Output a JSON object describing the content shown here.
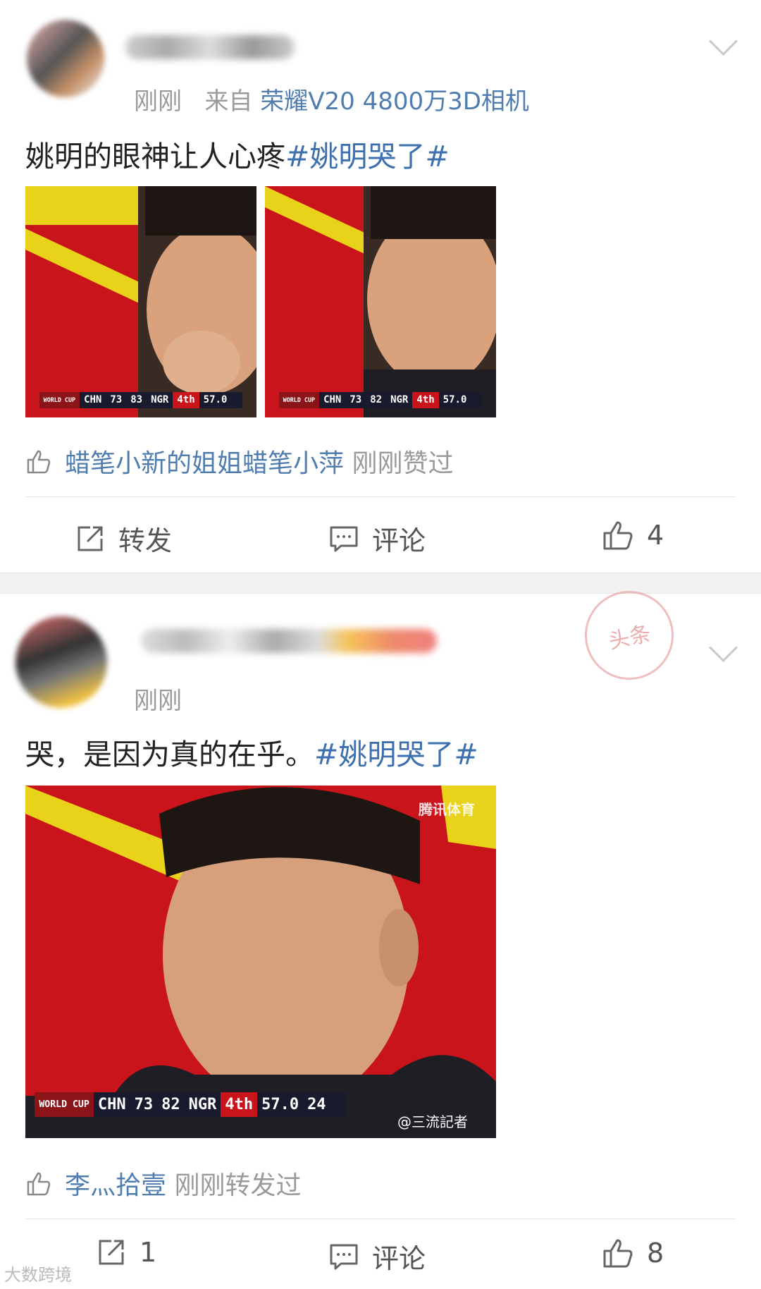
{
  "post1": {
    "time": "刚刚",
    "from_prefix": "来自",
    "source": "荣耀V20 4800万3D相机",
    "text": "姚明的眼神让人心疼",
    "hashtag": "#姚明哭了#",
    "images": [
      {
        "scoreboard": {
          "event": "WORLD CUP",
          "team1": "CHN",
          "score1": "73",
          "score2": "83",
          "team2": "NGR",
          "period": "4th",
          "clock": "57.0"
        }
      },
      {
        "scoreboard": {
          "event": "WORLD CUP",
          "team1": "CHN",
          "score1": "73",
          "score2": "82",
          "team2": "NGR",
          "period": "4th",
          "clock": "57.0"
        }
      }
    ],
    "liked_by": "蜡笔小新的姐姐蜡笔小萍",
    "liked_action": "刚刚赞过",
    "actions": {
      "repost": "转发",
      "comment": "评论",
      "likes": "4"
    }
  },
  "post2": {
    "time": "刚刚",
    "text": "哭，是因为真的在乎。",
    "hashtag": "#姚明哭了#",
    "image": {
      "logo": "腾讯体育",
      "credit": "@三流記者",
      "scoreboard": {
        "event": "WORLD CUP",
        "team1": "CHN",
        "score1": "73",
        "score2": "82",
        "team2": "NGR",
        "period": "4th",
        "clock": "57.0",
        "shot": "24"
      }
    },
    "liked_by": "李灬拾壹",
    "liked_action": "刚刚转发过",
    "actions": {
      "repost": "1",
      "comment": "评论",
      "likes": "8"
    }
  },
  "stamp": "头条",
  "watermark": "大数跨境",
  "colors": {
    "link": "#507daf",
    "hashtag": "#3e6fae",
    "meta": "#9a9a9a"
  }
}
